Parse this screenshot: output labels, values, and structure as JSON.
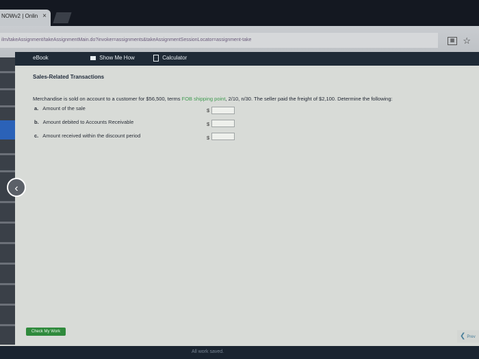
{
  "browser": {
    "tab_title": "NOWv2 | Onlin",
    "tab_close": "×",
    "new_tab": "+",
    "url": "ilm/takeAssignment/takeAssignmentMain.do?invoker=assignments&takeAssignmentSessionLocator=assignment-take"
  },
  "toolbar": {
    "ebook": "eBook",
    "show_me_how": "Show Me How",
    "calculator": "Calculator"
  },
  "problem": {
    "title": "Sales-Related Transactions",
    "question_pre": "Merchandise is sold on account to a customer for $56,500, terms ",
    "question_link": "FOB shipping point",
    "question_post": ", 2/10, n/30. The seller paid the freight of $2,100. Determine the following:",
    "items": [
      {
        "letter": "a.",
        "label": "Amount of the sale",
        "currency": "$",
        "value": ""
      },
      {
        "letter": "b.",
        "label": "Amount debited to Accounts Receivable",
        "currency": "$",
        "value": ""
      },
      {
        "letter": "c.",
        "label": "Amount received within the discount period",
        "currency": "$",
        "value": ""
      }
    ]
  },
  "actions": {
    "check_my_work": "Check My Work",
    "previous": "Prev"
  },
  "status": {
    "saved": "All work saved."
  },
  "colors": {
    "toolbar_bg": "#1f2a36",
    "check_button": "#2f8a3c",
    "link": "#3f9a4f"
  }
}
